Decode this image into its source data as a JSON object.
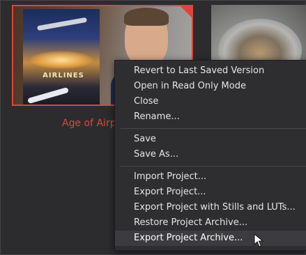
{
  "project_tile": {
    "label": "Age of Airp",
    "poster_title": "AIRLINES",
    "accent_color": "#e0443a"
  },
  "context_menu": {
    "groups": [
      [
        {
          "label": "Revert to Last Saved Version"
        },
        {
          "label": "Open in Read Only Mode"
        },
        {
          "label": "Close"
        },
        {
          "label": "Rename..."
        }
      ],
      [
        {
          "label": "Save"
        },
        {
          "label": "Save As..."
        }
      ],
      [
        {
          "label": "Import Project..."
        },
        {
          "label": "Export Project..."
        },
        {
          "label": "Export Project with Stills and LUTs..."
        },
        {
          "label": "Restore Project Archive..."
        },
        {
          "label": "Export Project Archive...",
          "highlighted": true
        }
      ]
    ]
  },
  "cursor": {
    "icon": "arrow-cursor-icon"
  }
}
